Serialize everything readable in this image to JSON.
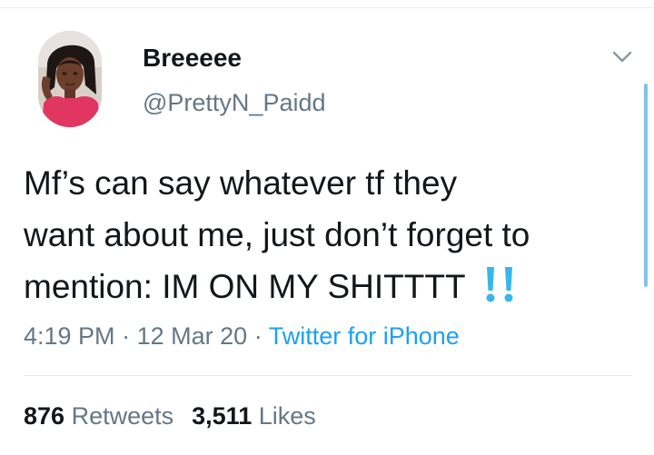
{
  "tweet": {
    "author": {
      "display_name": "Breeeee",
      "handle": "@PrettyN_Paidd"
    },
    "text_lines": [
      "Mf’s can say whatever tf they",
      "want about me, just don’t forget to",
      "mention: IM ON MY SHITTTT"
    ],
    "emoji": "double-exclamation-mark",
    "meta": {
      "time": "4:19 PM",
      "separator": "·",
      "date": "12 Mar 20",
      "source": "Twitter for iPhone"
    },
    "stats": {
      "retweets_count": "876",
      "retweets_label": "Retweets",
      "likes_count": "3,511",
      "likes_label": "Likes"
    }
  },
  "colors": {
    "text_primary": "#14171a",
    "text_secondary": "#657786",
    "link_blue": "#1da1f2",
    "emoji_blue": "#39b6ec",
    "divider": "#e1e8ed",
    "scroll_indicator": "#7fc3ef"
  },
  "icons": {
    "menu": "chevron-down-icon",
    "emoji": "double-exclamation-icon"
  }
}
